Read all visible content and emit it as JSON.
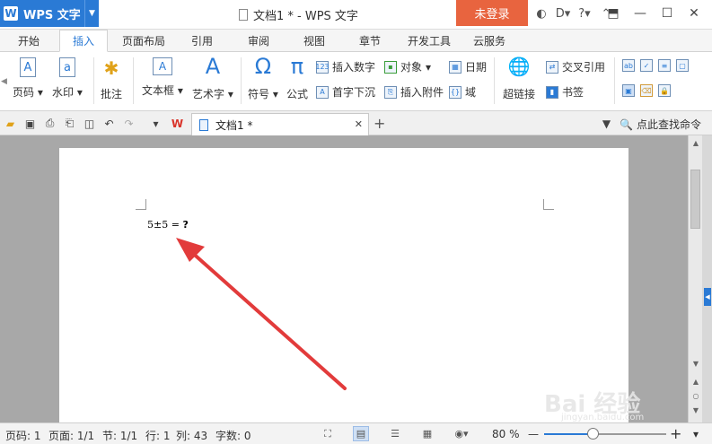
{
  "app": {
    "name": "WPS 文字",
    "logo_letter": "W",
    "window_title": "文档1 * - WPS 文字",
    "login_label": "未登录"
  },
  "title_tools": [
    "◐",
    "D▾",
    "?▾",
    "⌃"
  ],
  "window_controls": [
    "⬒",
    "—",
    "☐",
    "✕"
  ],
  "menu": {
    "tabs": [
      "开始",
      "插入",
      "页面布局",
      "引用",
      "审阅",
      "视图",
      "章节",
      "开发工具",
      "云服务"
    ],
    "active_tab": "插入"
  },
  "ribbon": {
    "page_number": "页码",
    "watermark": "水印",
    "comment": "批注",
    "text_box": "文本框",
    "word_art": "艺术字",
    "symbol": "符号",
    "formula": "公式",
    "insert_number": "插入数字",
    "object": "对象",
    "date": "日期",
    "drop_cap": "首字下沉",
    "insert_attachment": "插入附件",
    "field": "域",
    "hyperlink": "超链接",
    "cross_reference": "交叉引用",
    "bookmark": "书签",
    "icons": {
      "page_number": "A",
      "watermark": "a",
      "symbol": "Ω",
      "formula": "π",
      "word_art": "A"
    }
  },
  "doc_tab": {
    "name": "文档1 *",
    "close": "✕",
    "add": "+"
  },
  "find_command": "点此查找命令",
  "document": {
    "expression": "5±5 =",
    "question_mark": "?"
  },
  "watermark": {
    "main": "Bai 经验",
    "sub": "jingyan.baidu.com"
  },
  "status": {
    "page_num": "页码: 1",
    "pages": "页面: 1/1",
    "section": "节: 1/1",
    "line": "行: 1",
    "column": "列: 43",
    "word_count": "字数: 0",
    "zoom_percent": "80 %",
    "zoom_minus": "—",
    "zoom_plus": "+",
    "zoom_level": 0.4
  },
  "colors": {
    "accent": "#2a7ad5",
    "login": "#e8643f",
    "arrow": "#e23b3b"
  }
}
